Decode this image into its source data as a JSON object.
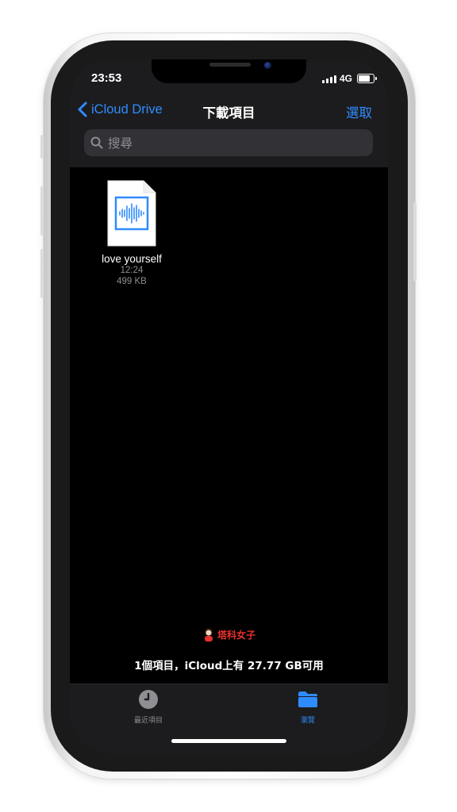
{
  "status_bar": {
    "time": "23:53",
    "network": "4G"
  },
  "nav": {
    "back_label": "iCloud Drive",
    "title": "下載項目",
    "select_label": "選取"
  },
  "search": {
    "placeholder": "搜尋"
  },
  "files": [
    {
      "name": "love yourself",
      "time": "12:24",
      "size": "499 KB",
      "icon": "audio-waveform-file-icon"
    }
  ],
  "watermark": {
    "text": "塔科女子"
  },
  "footer": {
    "summary": "1個項目，iCloud上有 27.77 GB可用"
  },
  "tabbar": {
    "tabs": [
      {
        "label": "最近項目",
        "icon": "clock-icon",
        "active": false
      },
      {
        "label": "瀏覽",
        "icon": "folder-icon",
        "active": true
      }
    ]
  },
  "colors": {
    "accent": "#2f8cff",
    "background": "#000000",
    "bar": "#1c1c1e",
    "secondary_text": "#8e8e93",
    "inactive_tab": "#8e8e93",
    "watermark": "#e8302f"
  }
}
